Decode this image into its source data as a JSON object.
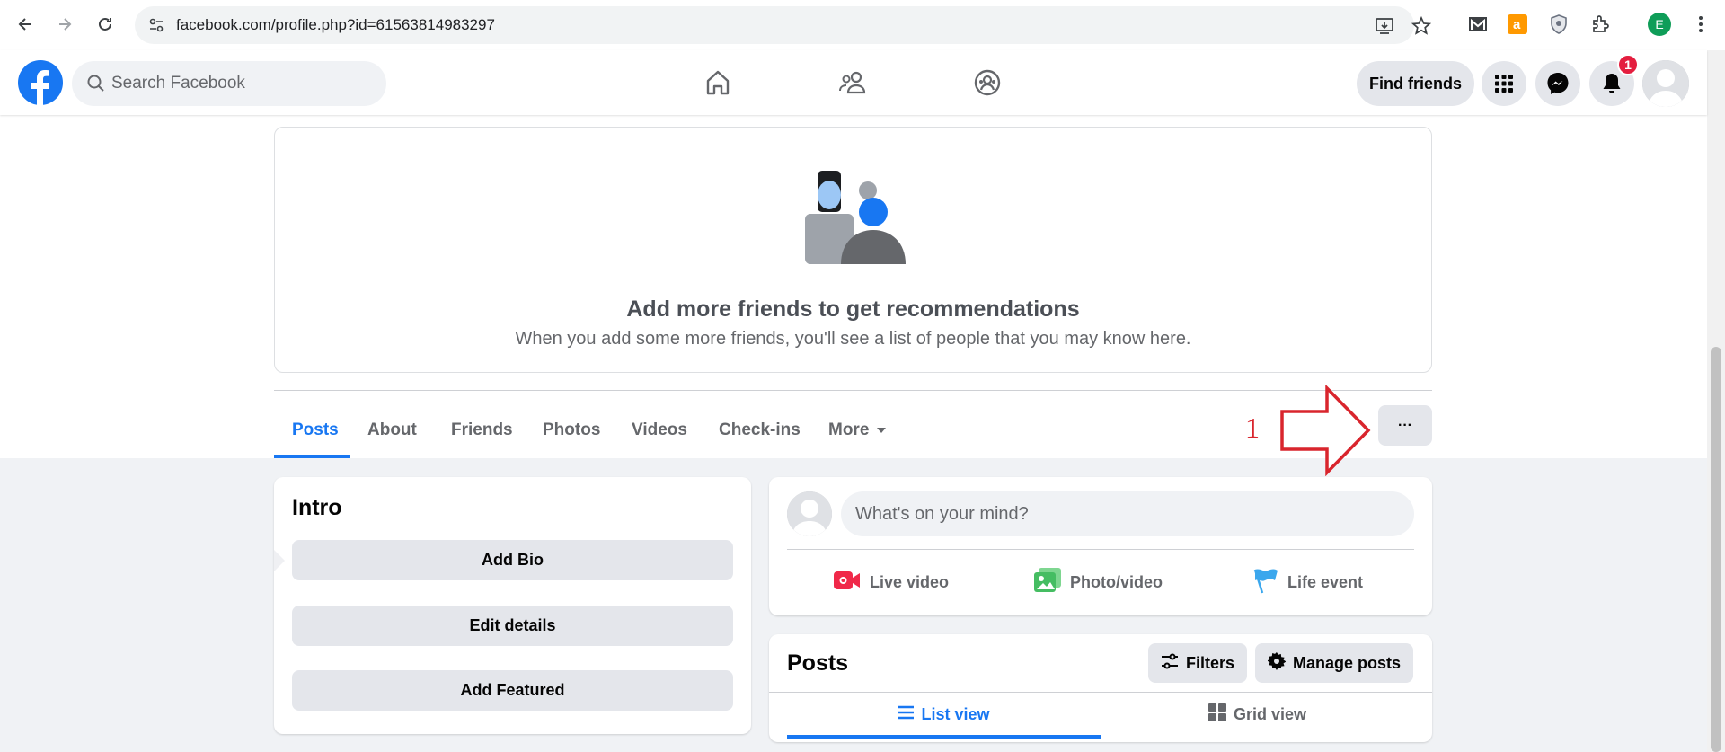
{
  "browser": {
    "url": "facebook.com/profile.php?id=61563814983297",
    "profile_initial": "E"
  },
  "header": {
    "search_placeholder": "Search Facebook",
    "find_friends_label": "Find friends",
    "notification_count": "1"
  },
  "recommendations": {
    "title": "Add more friends to get recommendations",
    "subtitle": "When you add some more friends, you'll see a list of people that you may know here."
  },
  "profile_tabs": [
    {
      "label": "Posts",
      "active": true
    },
    {
      "label": "About"
    },
    {
      "label": "Friends"
    },
    {
      "label": "Photos"
    },
    {
      "label": "Videos"
    },
    {
      "label": "Check-ins"
    },
    {
      "label": "More"
    }
  ],
  "annotation": {
    "number": "1",
    "color": "#d9252d"
  },
  "more_button_label": "···",
  "intro": {
    "title": "Intro",
    "buttons": [
      "Add Bio",
      "Edit details",
      "Add Featured"
    ]
  },
  "composer": {
    "placeholder": "What's on your mind?",
    "actions": [
      {
        "label": "Live video",
        "icon": "live-video-icon",
        "color": "#f02849"
      },
      {
        "label": "Photo/video",
        "icon": "photo-icon",
        "color": "#45bd62"
      },
      {
        "label": "Life event",
        "icon": "flag-icon",
        "color": "#3ba7ed"
      }
    ]
  },
  "posts": {
    "title": "Posts",
    "filters_label": "Filters",
    "manage_label": "Manage posts",
    "list_view_label": "List view",
    "grid_view_label": "Grid view"
  },
  "colors": {
    "brand": "#1877f2",
    "background": "#f0f2f5"
  }
}
